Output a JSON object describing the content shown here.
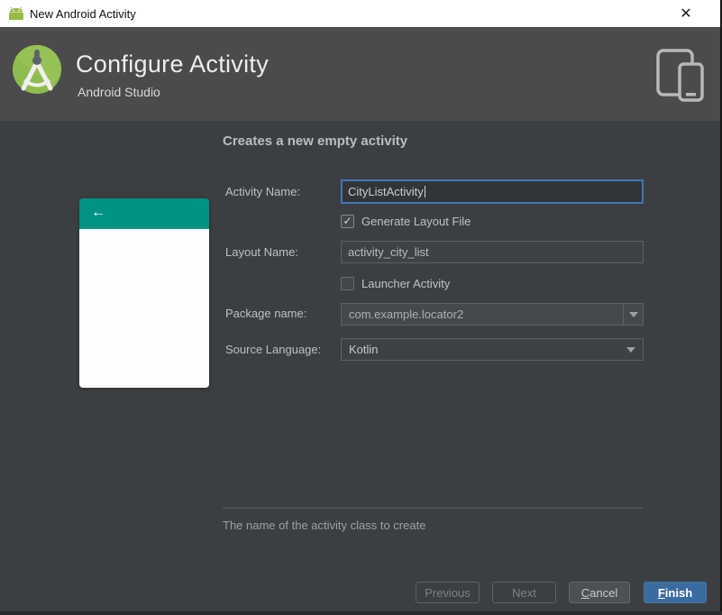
{
  "window": {
    "title": "New Android Activity",
    "close_glyph": "✕"
  },
  "header": {
    "title": "Configure Activity",
    "subtitle": "Android Studio"
  },
  "main": {
    "heading": "Creates a new empty activity",
    "preview": {
      "back_arrow": "←"
    },
    "form": {
      "activity_name": {
        "label": "Activity Name:",
        "value": "CityListActivity"
      },
      "generate_layout_file": {
        "label": "Generate Layout File",
        "checked": true,
        "checkmark": "✓"
      },
      "layout_name": {
        "label": "Layout Name:",
        "value": "activity_city_list"
      },
      "launcher_activity": {
        "label": "Launcher Activity",
        "checked": false
      },
      "package_name": {
        "label": "Package name:",
        "value": "com.example.locator2"
      },
      "source_language": {
        "label": "Source Language:",
        "value": "Kotlin"
      }
    },
    "hint": "The name of the activity class to create"
  },
  "footer": {
    "previous": "Previous",
    "next": "Next",
    "cancel": {
      "mnemonic": "C",
      "rest": "ancel"
    },
    "finish": {
      "mnemonic": "F",
      "rest": "inish"
    }
  },
  "colors": {
    "titlebar_bg": "#ffffff",
    "banner_bg": "#4b4b4b",
    "body_bg": "#3c3f41",
    "focus_border": "#3e77ba",
    "preview_toolbar_teal": "#009384",
    "logo_green": "#97c15f",
    "finish_button_blue": "#3a6ba1"
  }
}
